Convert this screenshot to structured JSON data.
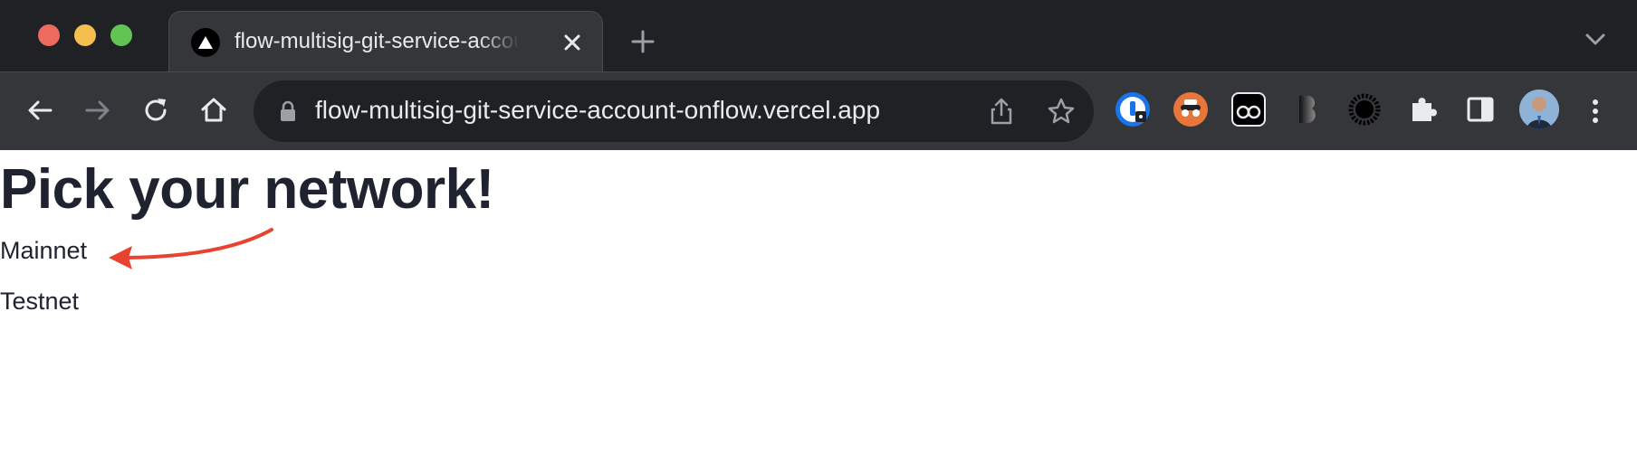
{
  "browser": {
    "tab": {
      "title": "flow-multisig-git-service-account-onflow.vercel.app"
    },
    "address_bar": {
      "url": "flow-multisig-git-service-account-onflow.vercel.app"
    },
    "extensions": [
      "1password-icon",
      "incognito-extension-icon",
      "glasses-extension-icon",
      "b-extension-icon",
      "sun-extension-icon",
      "puzzle-extensions-icon"
    ],
    "colors": {
      "frame": "#202124",
      "toolbar": "#35363a",
      "text": "#e8eaed"
    }
  },
  "page": {
    "heading": "Pick your network!",
    "networks": [
      {
        "label": "Mainnet"
      },
      {
        "label": "Testnet"
      }
    ],
    "annotation_color": "#e8432e",
    "text_color": "#1f2330"
  }
}
